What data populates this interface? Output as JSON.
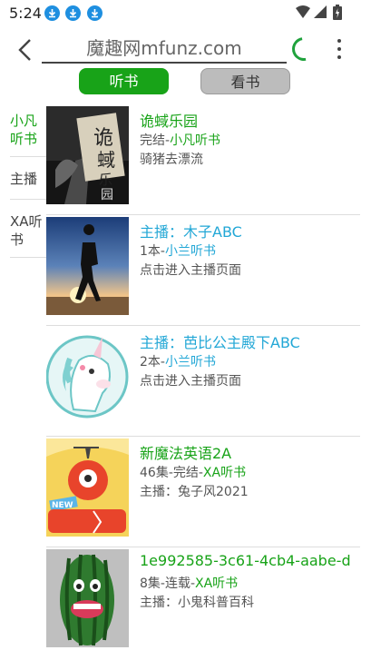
{
  "status": {
    "time": "5:24"
  },
  "search": {
    "text": "魔趣网mfunz.com"
  },
  "tabs": {
    "listen": "听书",
    "read": "看书"
  },
  "sidebar": {
    "items": [
      {
        "label": "小凡听书",
        "active": true
      },
      {
        "label": "主播",
        "active": false
      },
      {
        "label": "XA听书",
        "active": false
      }
    ]
  },
  "list": [
    {
      "title": "诡蜮乐园",
      "title_color": "green",
      "prefix": "完结-",
      "source": "小凡听书",
      "line3": "骑猪去漂流",
      "cover": "book-cover"
    },
    {
      "title": "主播：木子ABC",
      "title_color": "blue",
      "prefix": "1本-",
      "source": "小兰听书",
      "line3": "点击进入主播页面",
      "cover": "anchor-avatar"
    },
    {
      "title": "主播：芭比公主殿下ABC",
      "title_color": "blue",
      "prefix": "2本-",
      "source": "小兰听书",
      "line3": "点击进入主播页面",
      "cover": "unicorn-avatar"
    },
    {
      "title": "新魔法英语2A",
      "title_color": "green",
      "prefix": "46集-完结-",
      "source": "XA听书",
      "line3": "主播：兔子风2021",
      "cover": "new-magic-cover"
    },
    {
      "title": "1e992585-3c61-4cb4-aabe-d",
      "title_color": "green",
      "prefix": "8集-连载-",
      "source": "XA听书",
      "line3": "主播：小鬼科普百科",
      "cover": "watermelon-cover"
    }
  ],
  "colors": {
    "accent": "#18a318",
    "link_blue": "#22a7d6"
  }
}
